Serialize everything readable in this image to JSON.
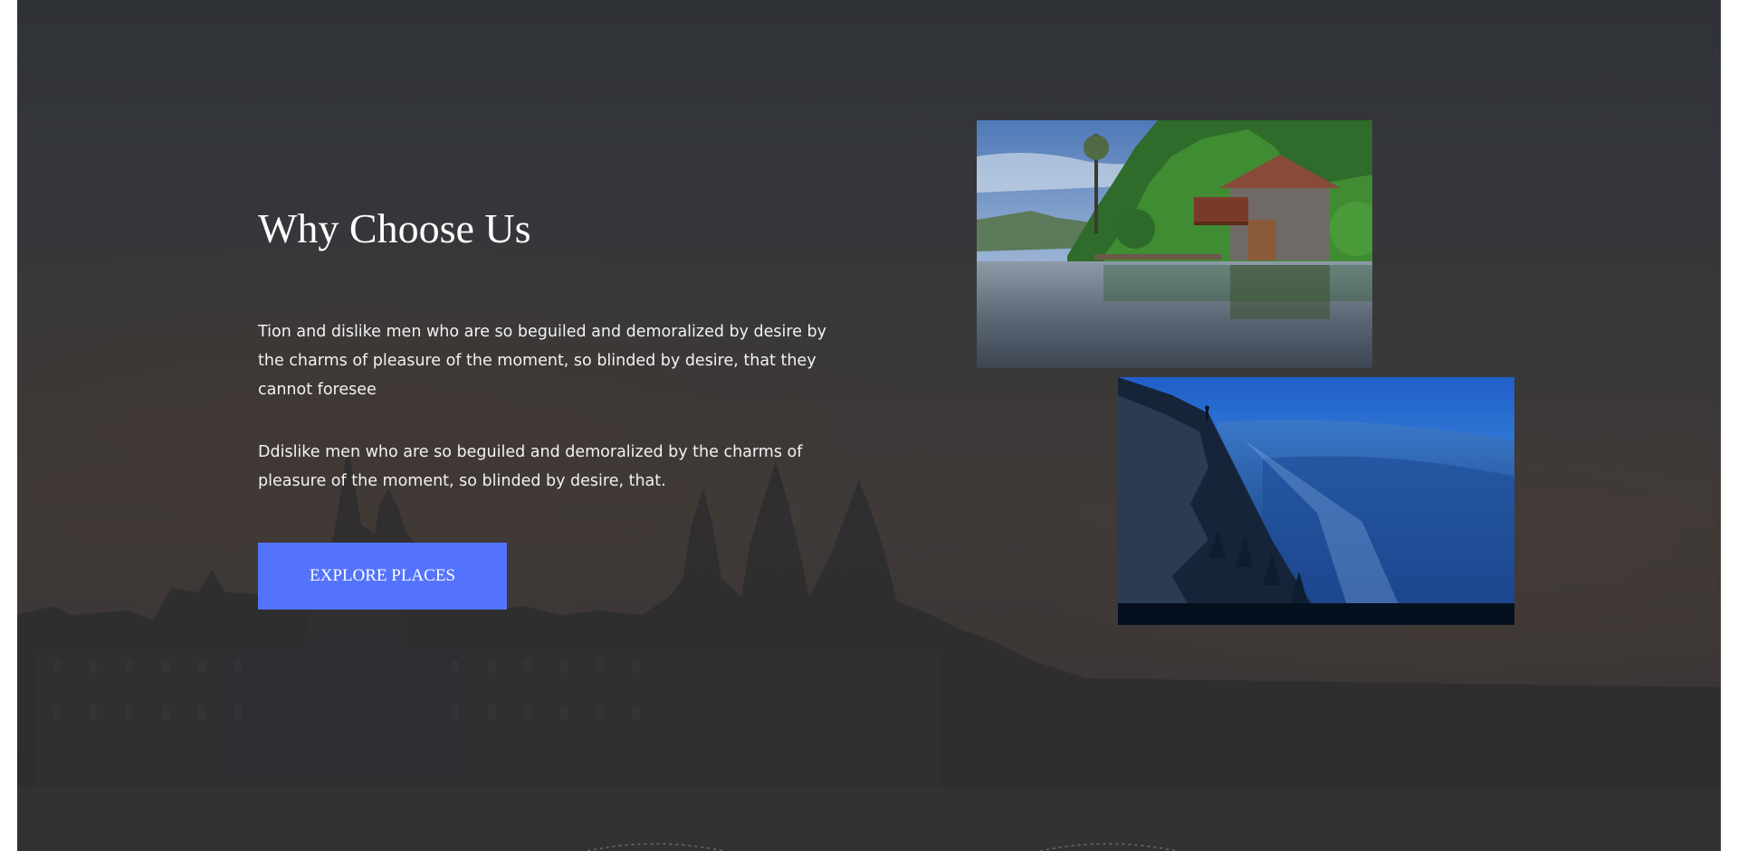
{
  "section": {
    "title": "Why Choose Us",
    "paragraphs": [
      "Tion and dislike men who are so beguiled and demoralized by desire by the charms of pleasure of the moment, so blinded by desire, that they cannot foresee",
      "Ddislike men who are so beguiled and demoralized by the charms of pleasure of the moment, so blinded by desire, that."
    ],
    "cta_label": "EXPLORE PLACES"
  },
  "images": {
    "lake_boathouse": "lakeside-boathouse-photo",
    "mountain_valley": "mountain-valley-photo",
    "background": "castle-silhouette-background"
  },
  "colors": {
    "accent": "#5473fd",
    "background": "#36373a",
    "text": "#ffffff"
  }
}
